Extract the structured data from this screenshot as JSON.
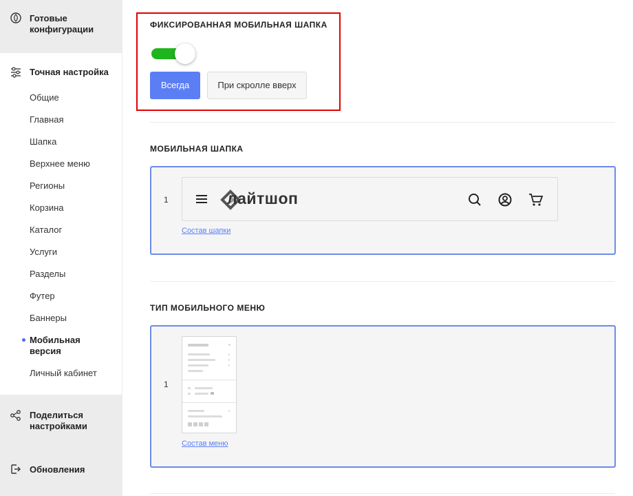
{
  "sidebar": {
    "presets_label": "Готовые конфигурации",
    "fine_tune_label": "Точная настройка",
    "items": [
      {
        "label": "Общие"
      },
      {
        "label": "Главная"
      },
      {
        "label": "Шапка"
      },
      {
        "label": "Верхнее меню"
      },
      {
        "label": "Регионы"
      },
      {
        "label": "Корзина"
      },
      {
        "label": "Каталог"
      },
      {
        "label": "Услуги"
      },
      {
        "label": "Разделы"
      },
      {
        "label": "Футер"
      },
      {
        "label": "Баннеры"
      },
      {
        "label": "Мобильная версия"
      },
      {
        "label": "Личный кабинет"
      }
    ],
    "active_item": "Мобильная версия",
    "share_label": "Поделиться настройками",
    "updates_label": "Обновления"
  },
  "fixed_header": {
    "title": "ФИКСИРОВАННАЯ МОБИЛЬНАЯ ШАПКА",
    "toggle_on": true,
    "options": [
      "Всегда",
      "При скролле вверх"
    ],
    "selected_option": "Всегда"
  },
  "mobile_header": {
    "title": "МОБИЛЬНАЯ ШАПКА",
    "row_number": "1",
    "logo_text": "лайтшоп",
    "link_label": "Состав шапки"
  },
  "mobile_menu": {
    "title": "ТИП МОБИЛЬНОГО МЕНЮ",
    "row_number": "1",
    "link_label": "Состав меню"
  },
  "colors": {
    "accent": "#5b7ef5",
    "toggle_on": "#1fb51f",
    "highlight_border": "#e00000",
    "panel_border": "#6b8be8"
  }
}
